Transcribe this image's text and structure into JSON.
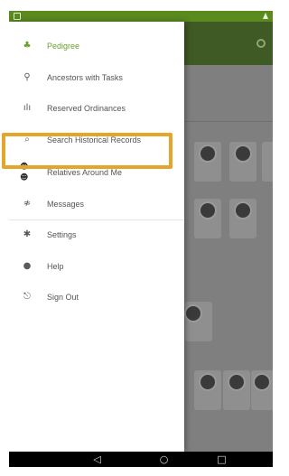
{
  "drawer": {
    "items": [
      {
        "label": "Pedigree",
        "icon": "tree-icon"
      },
      {
        "label": "Ancestors with Tasks",
        "icon": "tasks-icon"
      },
      {
        "label": "Reserved Ordinances",
        "icon": "bar-chart-icon"
      },
      {
        "label": "Search Historical Records",
        "icon": "search-records-icon"
      },
      {
        "label": "Relatives Around Me",
        "icon": "relatives-icon"
      },
      {
        "label": "Messages",
        "icon": "messages-icon"
      },
      {
        "label": "Settings",
        "icon": "gear-icon"
      },
      {
        "label": "Help",
        "icon": "help-icon"
      },
      {
        "label": "Sign Out",
        "icon": "sign-out-icon"
      }
    ],
    "active_item": "Pedigree",
    "highlighted_item": "Relatives Around Me"
  },
  "colors": {
    "status_bar": "#5b8a1f",
    "app_bar": "#3f5a24",
    "active": "#6aa12a",
    "highlight": "#e3a52a"
  },
  "nav_bar": {
    "back_icon": "back-icon",
    "home_icon": "home-icon",
    "recents_icon": "recents-icon"
  }
}
